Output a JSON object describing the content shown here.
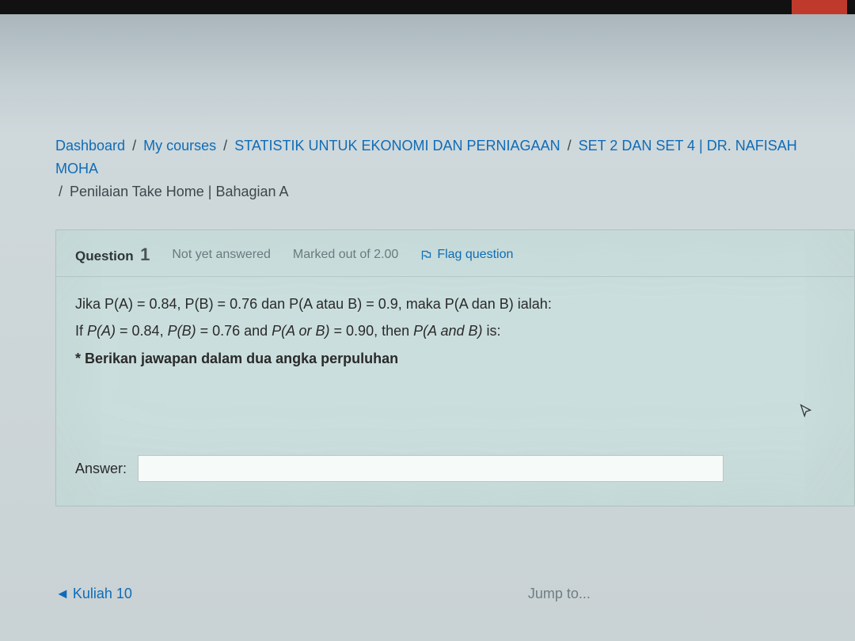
{
  "breadcrumb": {
    "items": [
      "Dashboard",
      "My courses",
      "STATISTIK UNTUK EKONOMI DAN PERNIAGAAN",
      "SET 2 DAN SET 4 | DR. NAFISAH MOHA",
      "Penilaian Take Home | Bahagian A"
    ]
  },
  "question": {
    "label": "Question",
    "number": "1",
    "status": "Not yet answered",
    "marks": "Marked out of 2.00",
    "flag": "Flag question",
    "line1": "Jika P(A) = 0.84, P(B) = 0.76  dan P(A atau B) = 0.9, maka P(A dan B) ialah:",
    "line2_a": "If ",
    "line2_b": "P(A)",
    "line2_c": " = 0.84, ",
    "line2_d": "P(B)",
    "line2_e": " = 0.76 and ",
    "line2_f": "P(A or B)",
    "line2_g": " = 0.90, then ",
    "line2_h": "P(A and B)",
    "line2_i": " is:",
    "line3": "* Berikan jawapan dalam dua angka perpuluhan",
    "answer_label": "Answer:",
    "answer_value": ""
  },
  "nav": {
    "back": "Kuliah 10",
    "jump": "Jump to..."
  }
}
